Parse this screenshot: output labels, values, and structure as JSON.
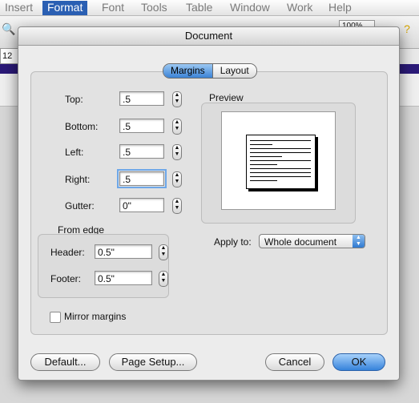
{
  "menubar": {
    "items": [
      "Insert",
      "Format",
      "Font",
      "Tools",
      "Table",
      "Window",
      "Work",
      "Help"
    ],
    "active_index": 1
  },
  "toolbar": {
    "zoom": "100%",
    "font_size": "12"
  },
  "dialog": {
    "title": "Document",
    "tabs": [
      {
        "label": "Margins",
        "selected": true
      },
      {
        "label": "Layout",
        "selected": false
      }
    ],
    "margins": {
      "top": {
        "label": "Top:",
        "value": ".5"
      },
      "bottom": {
        "label": "Bottom:",
        "value": ".5"
      },
      "left": {
        "label": "Left:",
        "value": ".5"
      },
      "right": {
        "label": "Right:",
        "value": ".5"
      },
      "gutter": {
        "label": "Gutter:",
        "value": "0\""
      }
    },
    "from_edge": {
      "title": "From edge",
      "header": {
        "label": "Header:",
        "value": "0.5\""
      },
      "footer": {
        "label": "Footer:",
        "value": "0.5\""
      }
    },
    "preview": {
      "title": "Preview"
    },
    "apply_to": {
      "label": "Apply to:",
      "value": "Whole document"
    },
    "mirror_margins": {
      "label": "Mirror margins",
      "checked": false
    },
    "buttons": {
      "default": "Default...",
      "page_setup": "Page Setup...",
      "cancel": "Cancel",
      "ok": "OK"
    }
  },
  "colors": {
    "accent": "#3683db",
    "menu_active": "#2a5fb3",
    "purple_bar": "#2b1a78"
  }
}
